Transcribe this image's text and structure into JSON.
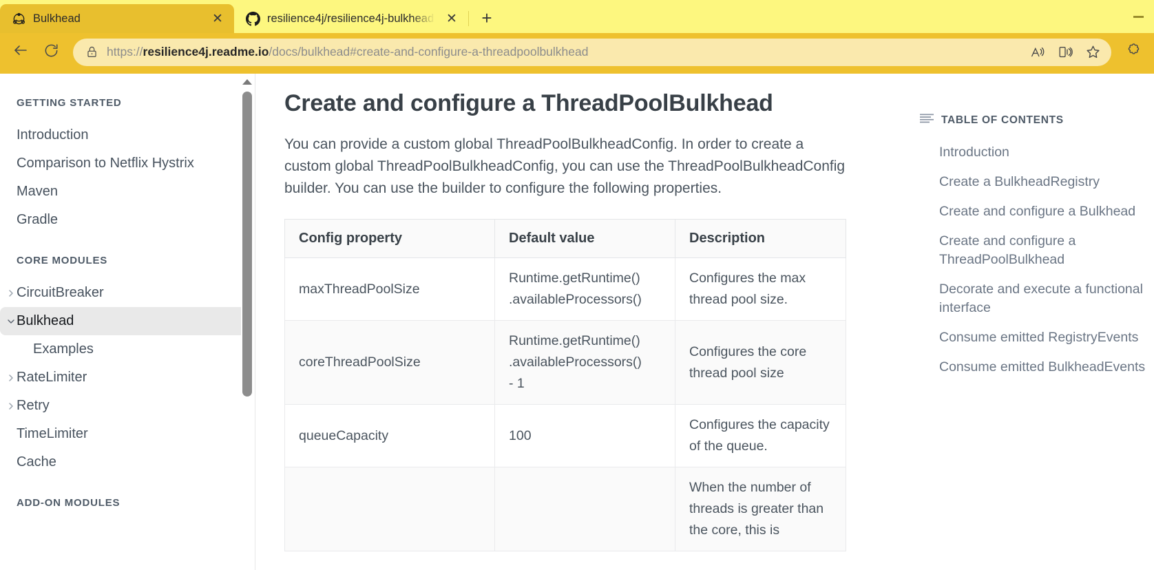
{
  "browser": {
    "tabs": [
      {
        "title": "Bulkhead",
        "favicon": "resilience4j-icon",
        "active": true,
        "close_label": "✕"
      },
      {
        "title": "resilience4j/resilience4j-bulkhead",
        "favicon": "github-icon",
        "active": false,
        "close_label": "✕"
      }
    ],
    "new_tab_label": "+",
    "window_controls": {
      "minimize": "minimize-button"
    },
    "toolbar": {
      "back_icon": "back-arrow-icon",
      "reload_icon": "reload-icon",
      "lock_icon": "lock-icon",
      "url_scheme": "https://",
      "url_host": "resilience4j.readme.io",
      "url_path": "/docs/bulkhead#create-and-configure-a-threadpoolbulkhead",
      "read_aloud_icon": "read-aloud-icon",
      "reading_view_icon": "immersive-reader-icon",
      "favorite_icon": "star-icon",
      "extensions_icon": "puzzle-piece-icon"
    },
    "chrome_colors": {
      "tabstrip_bg": "#fdf77f",
      "active_tab_bg": "#e8bf2e",
      "toolbar_bg": "#eec12e",
      "urlbar_bg": "#fae9ad"
    }
  },
  "sidebar": {
    "sections": [
      {
        "title": "GETTING STARTED",
        "items": [
          {
            "label": "Introduction",
            "expandable": false,
            "current": false,
            "sub": false
          },
          {
            "label": "Comparison to Netflix Hystrix",
            "expandable": false,
            "current": false,
            "sub": false
          },
          {
            "label": "Maven",
            "expandable": false,
            "current": false,
            "sub": false
          },
          {
            "label": "Gradle",
            "expandable": false,
            "current": false,
            "sub": false
          }
        ]
      },
      {
        "title": "CORE MODULES",
        "items": [
          {
            "label": "CircuitBreaker",
            "expandable": true,
            "expanded": false,
            "current": false,
            "sub": false
          },
          {
            "label": "Bulkhead",
            "expandable": true,
            "expanded": true,
            "current": true,
            "sub": false
          },
          {
            "label": "Examples",
            "expandable": false,
            "current": false,
            "sub": true
          },
          {
            "label": "RateLimiter",
            "expandable": true,
            "expanded": false,
            "current": false,
            "sub": false
          },
          {
            "label": "Retry",
            "expandable": true,
            "expanded": false,
            "current": false,
            "sub": false
          },
          {
            "label": "TimeLimiter",
            "expandable": false,
            "current": false,
            "sub": false
          },
          {
            "label": "Cache",
            "expandable": false,
            "current": false,
            "sub": false
          }
        ]
      },
      {
        "title": "ADD-ON MODULES",
        "items": []
      }
    ]
  },
  "main": {
    "title": "Create and configure a ThreadPoolBulkhead",
    "intro": "You can provide a custom global ThreadPoolBulkheadConfig. In order to create a custom global ThreadPoolBulkheadConfig, you can use the ThreadPoolBulkheadConfig builder. You can use the builder to configure the following properties.",
    "table": {
      "headers": [
        "Config property",
        "Default value",
        "Description"
      ],
      "rows": [
        {
          "property": "maxThreadPoolSize",
          "default": "Runtime.getRuntime()\n.availableProcessors()",
          "description": "Configures the max thread pool size."
        },
        {
          "property": "coreThreadPoolSize",
          "default": "Runtime.getRuntime()\n.availableProcessors()\n- 1",
          "description": "Configures the core thread pool size"
        },
        {
          "property": "queueCapacity",
          "default": "100",
          "description": "Configures the capacity of the queue."
        },
        {
          "property": "",
          "default": "",
          "description": "When the number of threads is greater than the core, this is"
        }
      ]
    }
  },
  "toc": {
    "icon": "lines-icon",
    "heading": "TABLE OF CONTENTS",
    "items": [
      "Introduction",
      "Create a BulkheadRegistry",
      "Create and configure a Bulkhead",
      "Create and configure a ThreadPoolBulkhead",
      "Decorate and execute a functional interface",
      "Consume emitted RegistryEvents",
      "Consume emitted BulkheadEvents"
    ]
  }
}
